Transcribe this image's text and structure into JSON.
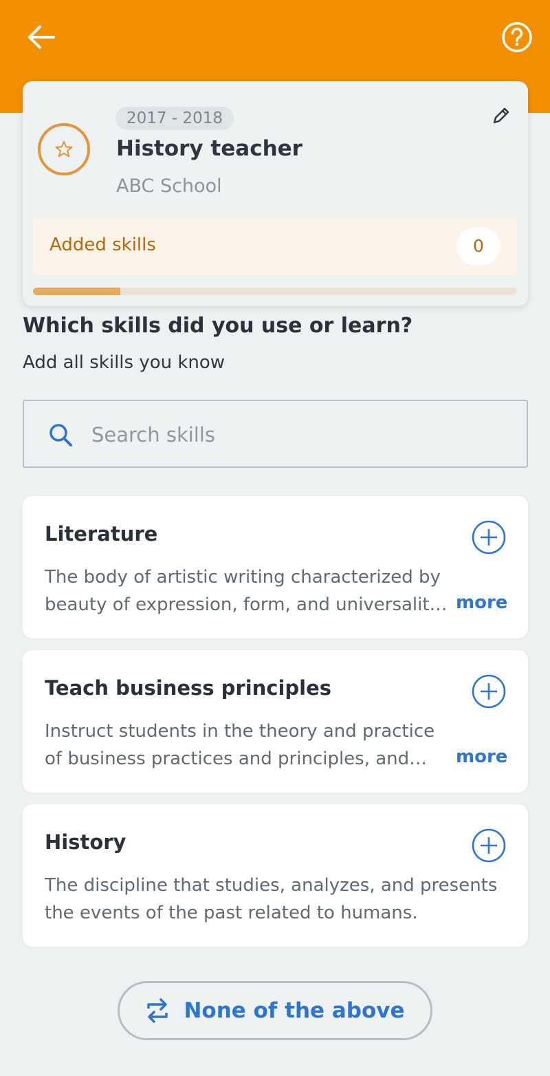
{
  "header": {
    "back_icon": "arrow-left-icon",
    "help_icon": "question-circle-icon",
    "bar_color": "#f28f00"
  },
  "job": {
    "year_range": "2017 - 2018",
    "title": "History teacher",
    "organization": "ABC School",
    "icon": "star-icon",
    "edit_icon": "pencil-icon",
    "added_skills_label": "Added skills",
    "added_skills_count": "0",
    "progress_fraction": 0.18
  },
  "prompt": {
    "question": "Which skills did you use or learn?",
    "subtitle": "Add all skills you know"
  },
  "search": {
    "placeholder": "Search skills",
    "value": ""
  },
  "skills": [
    {
      "title": "Literature",
      "description": "The body of artistic writing characterized by beauty of expression, form, and universalit…",
      "more_label": "more"
    },
    {
      "title": "Teach business principles",
      "description": "Instruct students in the theory and practice of business practices and principles, and…",
      "more_label": "more"
    },
    {
      "title": "History",
      "description": "The discipline that studies, analyzes, and presents the events of the past related to humans."
    }
  ],
  "footer": {
    "none_label": "None of the above",
    "none_icon": "swap-arrows-icon"
  },
  "colors": {
    "accent_blue": "#2f74cf",
    "orange": "#f28f00",
    "star_ring": "#e3963a"
  }
}
